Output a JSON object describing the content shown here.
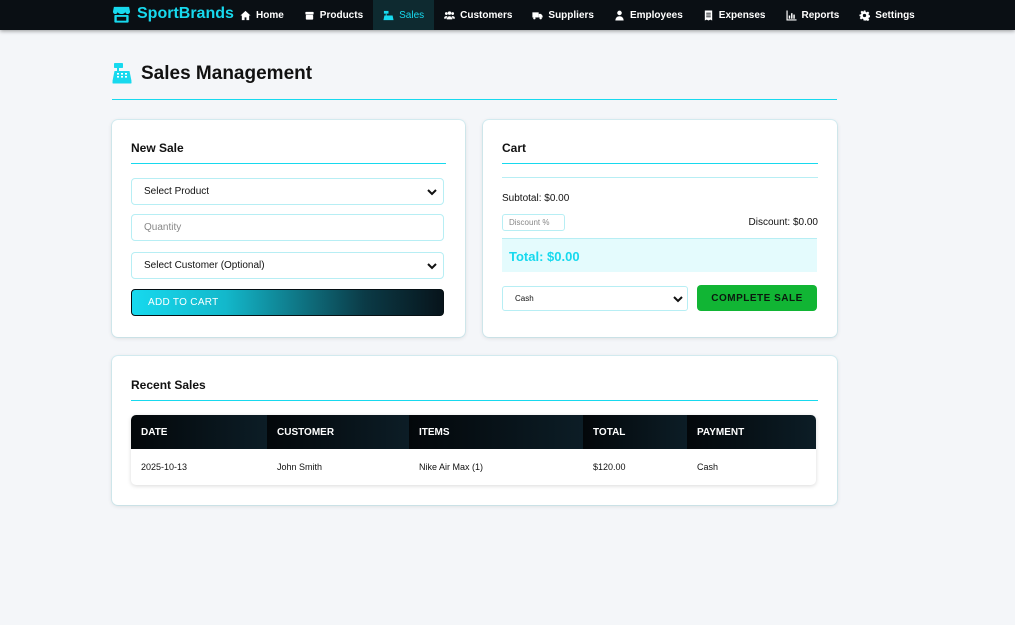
{
  "brand": {
    "name": "SportBrands",
    "logo_icon": "store-icon",
    "accent": "#17d9ee"
  },
  "nav": {
    "items": [
      {
        "label": "Home",
        "icon": "home-icon",
        "active": false
      },
      {
        "label": "Products",
        "icon": "box-icon",
        "active": false
      },
      {
        "label": "Sales",
        "icon": "cash-register-icon",
        "active": true
      },
      {
        "label": "Customers",
        "icon": "users-icon",
        "active": false
      },
      {
        "label": "Suppliers",
        "icon": "truck-icon",
        "active": false
      },
      {
        "label": "Employees",
        "icon": "user-icon",
        "active": false
      },
      {
        "label": "Expenses",
        "icon": "receipt-icon",
        "active": false
      },
      {
        "label": "Reports",
        "icon": "chart-icon",
        "active": false
      },
      {
        "label": "Settings",
        "icon": "gear-icon",
        "active": false
      }
    ]
  },
  "page": {
    "title": "Sales Management",
    "title_icon": "cash-register-icon"
  },
  "new_sale": {
    "title": "New Sale",
    "product_select": "Select Product",
    "quantity_placeholder": "Quantity",
    "customer_select": "Select Customer (Optional)",
    "add_button": "ADD TO CART"
  },
  "cart": {
    "title": "Cart",
    "subtotal": "Subtotal: $0.00",
    "discount_placeholder": "Discount %",
    "discount": "Discount: $0.00",
    "total": "Total: $0.00",
    "payment_method": "Cash",
    "complete_button": "COMPLETE SALE"
  },
  "recent_sales": {
    "title": "Recent Sales",
    "columns": [
      "DATE",
      "CUSTOMER",
      "ITEMS",
      "TOTAL",
      "PAYMENT"
    ],
    "rows": [
      [
        "2025-10-13",
        "John Smith",
        "Nike Air Max (1)",
        "$120.00",
        "Cash"
      ]
    ]
  },
  "colors": {
    "accent": "#17d9ee",
    "success": "#11b534",
    "nav_bg": "#0a0f14",
    "page_bg": "#f4f6f9"
  }
}
